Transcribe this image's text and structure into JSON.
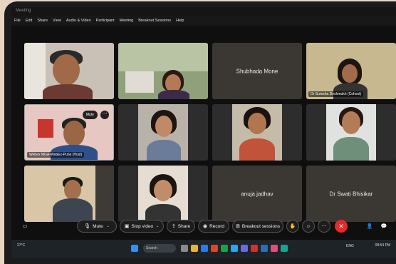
{
  "window": {
    "title": "Meeting"
  },
  "menu": [
    "File",
    "Edit",
    "Share",
    "View",
    "Audio & Video",
    "Participant",
    "Meeting",
    "Breakout Sessions",
    "Help"
  ],
  "tiles": {
    "t1": {
      "label": ""
    },
    "t2": {
      "label": ""
    },
    "t3": {
      "name": "Shubhada Mone"
    },
    "t4": {
      "label": "Dr Suresha Deshmukh (Cohost)"
    },
    "t5": {
      "label": "Webex MGA-WebEx-Pune (Host)",
      "mute": "Mute"
    },
    "t6": {
      "label": ""
    },
    "t7": {
      "label": ""
    },
    "t8": {
      "label": ""
    },
    "t9": {
      "label": ""
    },
    "t10": {
      "label": ""
    },
    "t11": {
      "name": "anuja jadhav"
    },
    "t12": {
      "name": "Dr Swati Bhisikar"
    }
  },
  "controls": {
    "mute": "Mute",
    "stop_video": "Stop video",
    "share": "Share",
    "record": "Record",
    "breakout": "Breakout sessions"
  },
  "taskbar": {
    "temperature": "27°C",
    "search": "Search",
    "lang": "ENG",
    "time": "08:54 PM"
  },
  "colors": {
    "end_call": "#e12b2b",
    "tile_bg": "#3b3732"
  }
}
